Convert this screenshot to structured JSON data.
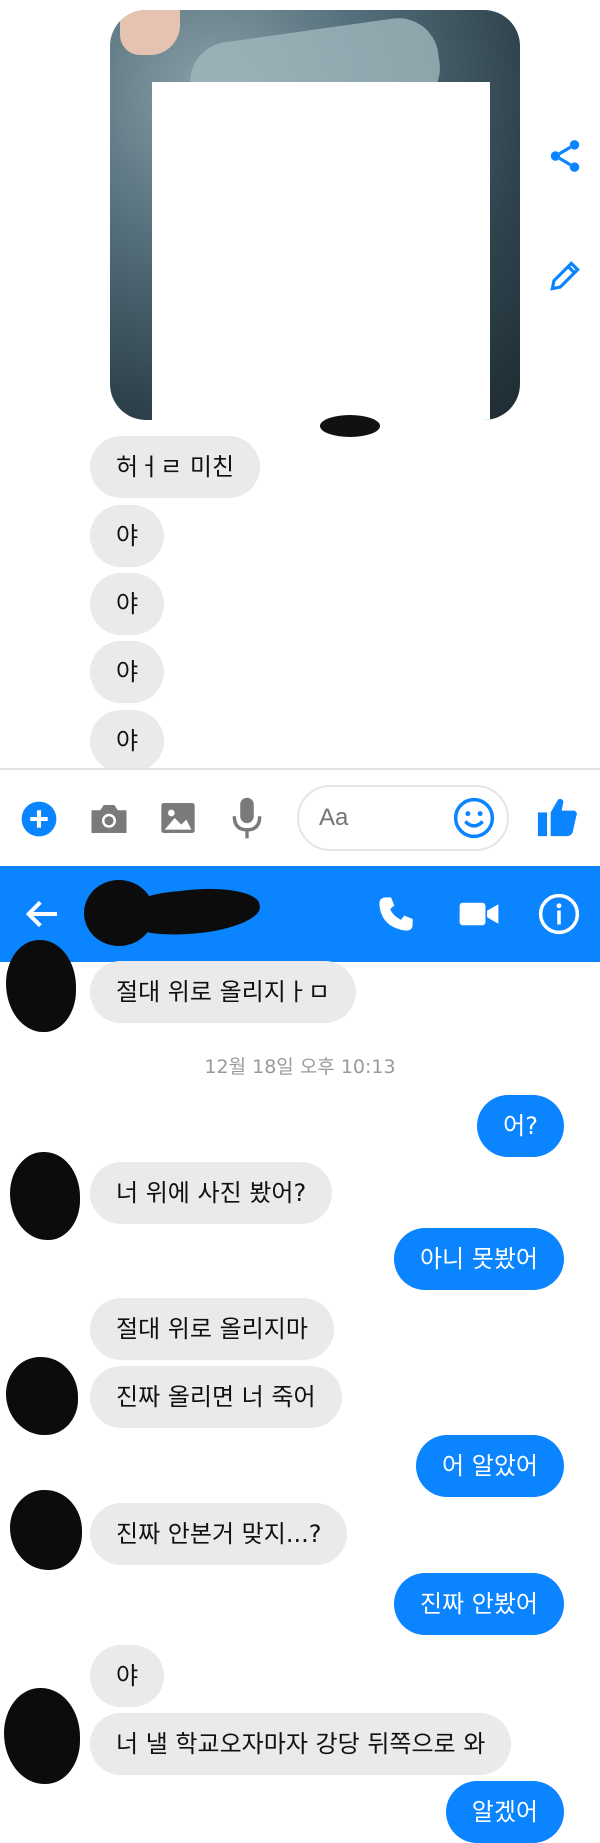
{
  "icons": {
    "share": "share-icon",
    "edit": "pencil-icon",
    "add": "plus-circle-icon",
    "camera": "camera-icon",
    "gallery": "image-icon",
    "mic": "microphone-icon",
    "emoji": "smiley-icon",
    "like": "thumbs-up-icon",
    "back": "back-arrow-icon",
    "call": "phone-icon",
    "video": "video-camera-icon",
    "info": "info-icon"
  },
  "colors": {
    "accent": "#0b84ff",
    "received_bubble": "#eaeaea",
    "sent_bubble": "#0b84ff"
  },
  "top_thread": {
    "messages": [
      "허ㅓㄹ 미친",
      "야",
      "야",
      "야",
      "야"
    ]
  },
  "composer": {
    "placeholder": "Aa"
  },
  "thread": {
    "first_message": "절대 위로 올리지ㅏㅁ",
    "timestamp": "12월 18일 오후 10:13",
    "messages": [
      {
        "from": "me",
        "text": "어?"
      },
      {
        "from": "them",
        "text": "너 위에 사진 봤어?"
      },
      {
        "from": "me",
        "text": "아니 못봤어"
      },
      {
        "from": "them",
        "text": "절대 위로 올리지마"
      },
      {
        "from": "them",
        "text": "진짜 올리면 너 죽어"
      },
      {
        "from": "me",
        "text": "어 알았어"
      },
      {
        "from": "them",
        "text": "진짜 안본거 맞지...?"
      },
      {
        "from": "me",
        "text": "진짜 안봤어"
      },
      {
        "from": "them",
        "text": "야"
      },
      {
        "from": "them",
        "text": "너 낼 학교오자마자 강당 뒤쪽으로 와"
      },
      {
        "from": "me",
        "text": "알겠어"
      }
    ]
  }
}
